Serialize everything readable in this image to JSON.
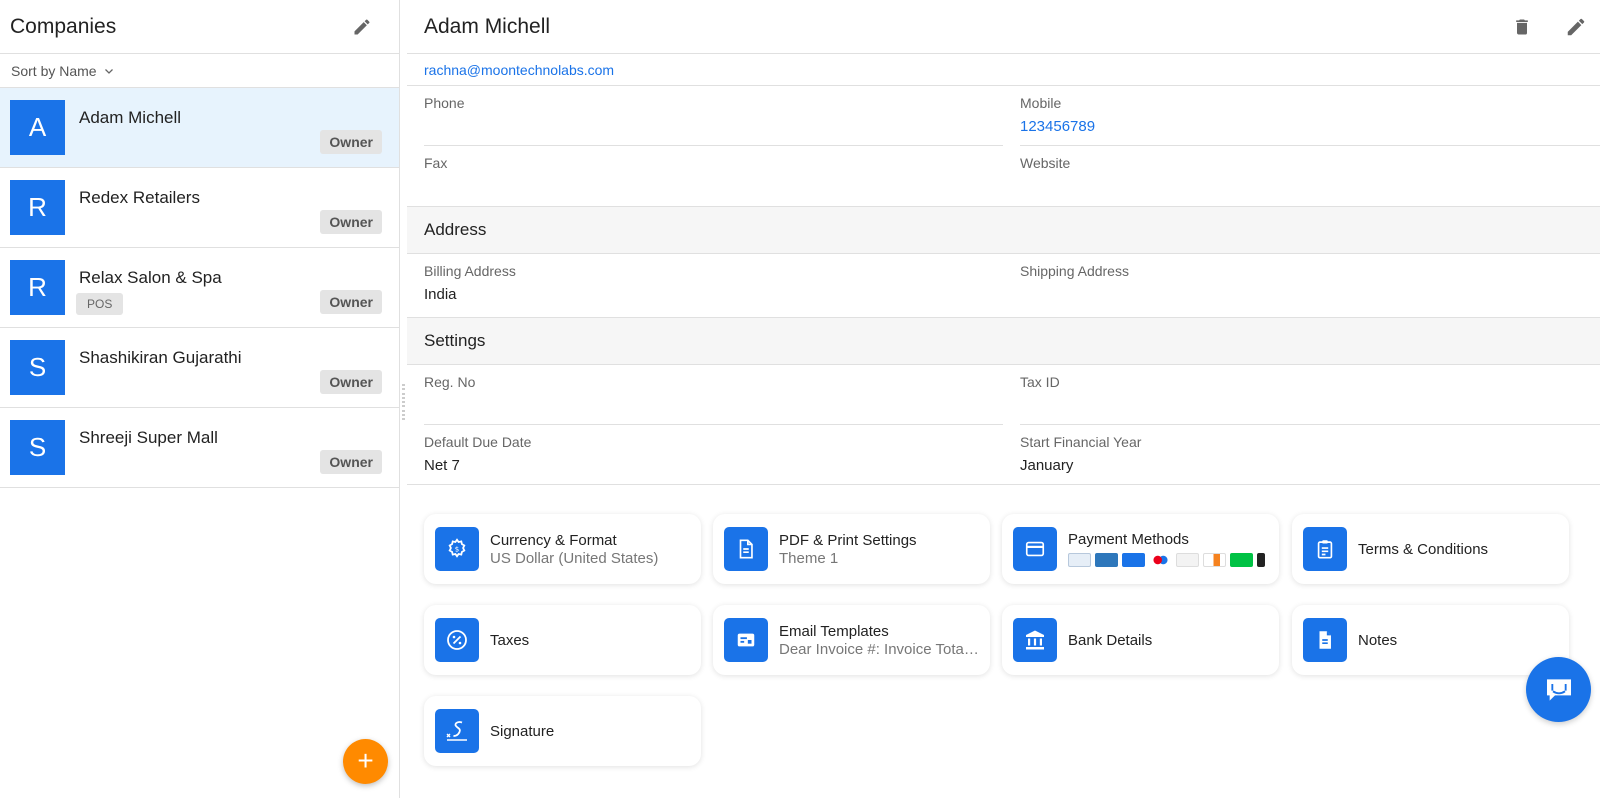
{
  "sidebar": {
    "title": "Companies",
    "sort_label": "Sort by Name",
    "companies": [
      {
        "initial": "A",
        "name": "Adam Michell",
        "role": "Owner",
        "tag": ""
      },
      {
        "initial": "R",
        "name": "Redex Retailers",
        "role": "Owner",
        "tag": ""
      },
      {
        "initial": "R",
        "name": "Relax Salon & Spa",
        "role": "Owner",
        "tag": "POS"
      },
      {
        "initial": "S",
        "name": "Shashikiran Gujarathi",
        "role": "Owner",
        "tag": ""
      },
      {
        "initial": "S",
        "name": "Shreeji Super Mall",
        "role": "Owner",
        "tag": ""
      }
    ],
    "add_button": "+"
  },
  "detail": {
    "title": "Adam Michell",
    "email": "rachna@moontechnolabs.com",
    "phone_label": "Phone",
    "phone_value": "",
    "mobile_label": "Mobile",
    "mobile_value": "123456789",
    "fax_label": "Fax",
    "fax_value": "",
    "website_label": "Website",
    "website_value": "",
    "address_heading": "Address",
    "billing_label": "Billing Address",
    "billing_value": "India",
    "shipping_label": "Shipping Address",
    "shipping_value": "",
    "settings_heading": "Settings",
    "reg_label": "Reg. No",
    "reg_value": "",
    "tax_label": "Tax ID",
    "tax_value": "",
    "due_label": "Default Due Date",
    "due_value": "Net 7",
    "fy_label": "Start Financial Year",
    "fy_value": "January"
  },
  "cards": [
    {
      "title": "Currency & Format",
      "sub": "US Dollar (United States)",
      "icon": "gear-icon"
    },
    {
      "title": "PDF & Print Settings",
      "sub": "Theme 1",
      "icon": "document-icon"
    },
    {
      "title": "Payment Methods",
      "sub": "",
      "icon": "credit-card-icon"
    },
    {
      "title": "Terms & Conditions",
      "sub": "",
      "icon": "clipboard-icon"
    },
    {
      "title": "Taxes",
      "sub": "",
      "icon": "percent-icon"
    },
    {
      "title": "Email Templates",
      "sub": "Dear Invoice #: Invoice Total ...",
      "icon": "email-template-icon"
    },
    {
      "title": "Bank Details",
      "sub": "",
      "icon": "bank-icon"
    },
    {
      "title": "Notes",
      "sub": "",
      "icon": "note-icon"
    },
    {
      "title": "Signature",
      "sub": "",
      "icon": "signature-icon"
    }
  ],
  "payment_logos": [
    "bank-transfer",
    "amex",
    "cash",
    "mastercard",
    "gpay",
    "discover",
    "cash-app",
    "other"
  ],
  "colors": {
    "accent": "#1a73e8",
    "fab": "#ff8a00",
    "selected_row": "#e7f3fd"
  }
}
